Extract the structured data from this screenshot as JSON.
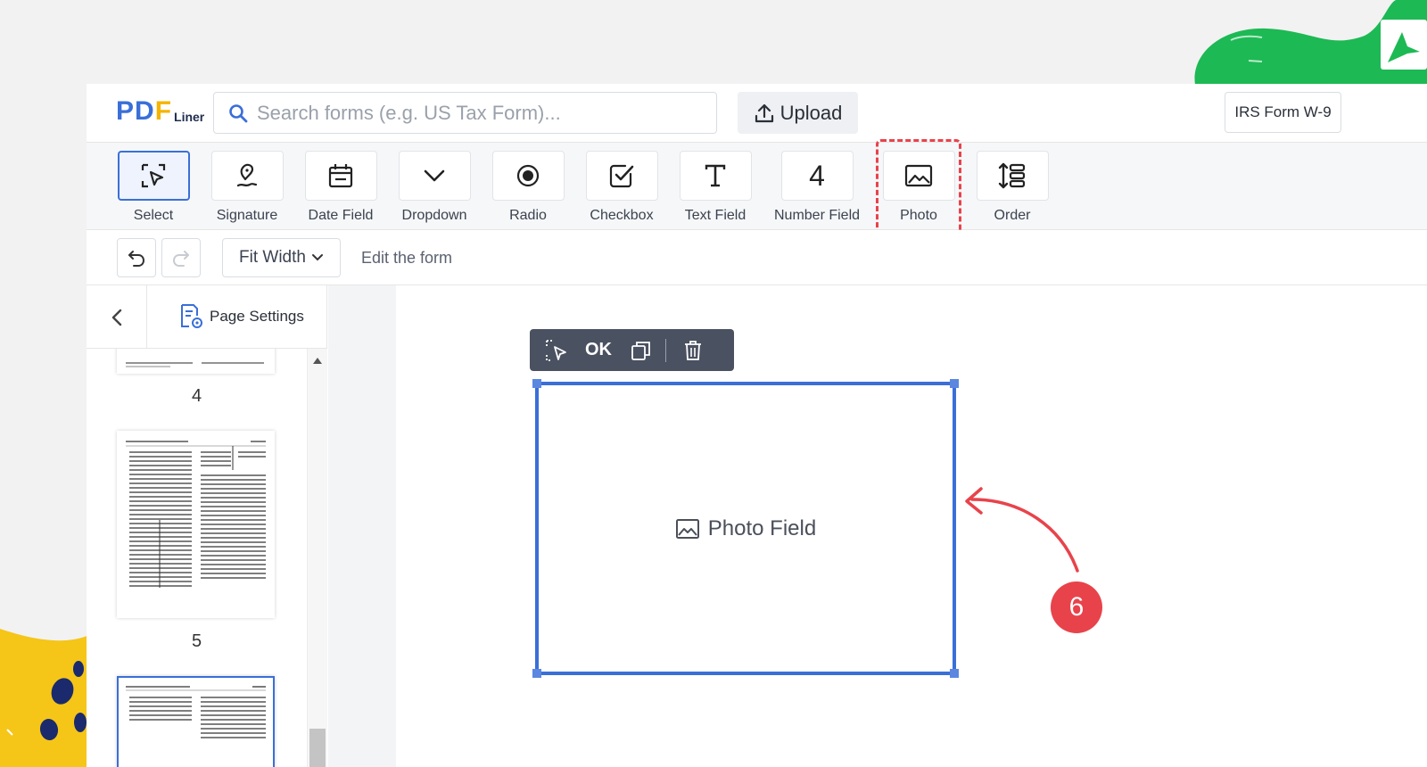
{
  "header": {
    "logo_main": "PDF",
    "logo_sub": "Liner",
    "search_placeholder": "Search forms (e.g. US Tax Form)...",
    "upload_label": "Upload",
    "form_name": "IRS Form W-9"
  },
  "toolbar": {
    "tools": [
      {
        "label": "Select",
        "icon": "select-cursor-icon"
      },
      {
        "label": "Signature",
        "icon": "signature-pen-icon"
      },
      {
        "label": "Date Field",
        "icon": "calendar-icon"
      },
      {
        "label": "Dropdown",
        "icon": "chevron-down-icon"
      },
      {
        "label": "Radio",
        "icon": "radio-icon"
      },
      {
        "label": "Checkbox",
        "icon": "checkbox-icon"
      },
      {
        "label": "Text Field",
        "icon": "text-t-icon"
      },
      {
        "label": "Number Field",
        "icon": "number-icon",
        "glyph": "4"
      },
      {
        "label": "Photo",
        "icon": "image-icon"
      },
      {
        "label": "Order",
        "icon": "order-icon"
      }
    ]
  },
  "subbar": {
    "zoom_label": "Fit Width",
    "mode_label": "Edit the form"
  },
  "left_panel": {
    "title": "Page Settings",
    "pages": [
      "4",
      "5"
    ]
  },
  "field": {
    "toolbar_ok": "OK",
    "label": "Photo Field"
  },
  "annotation": {
    "step": "6",
    "color": "#e8434b"
  },
  "colors": {
    "accent": "#3a6fd8",
    "brand_green": "#1db954",
    "brand_yellow": "#f5c518"
  }
}
